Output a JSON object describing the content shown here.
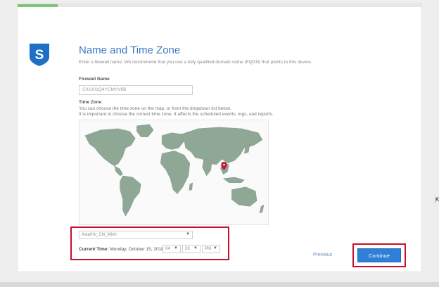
{
  "progress": {
    "fraction": 0.1
  },
  "header": {
    "logo_letter": "S",
    "title": "Name and Time Zone",
    "subtitle": "Enter a firewall name. We recommend that you use a fully qualified domain name (FQDN) that points to this device."
  },
  "firewall": {
    "label": "Firewall Name",
    "value": "C01001Q4YCMYV8B"
  },
  "timezone": {
    "label": "Time Zone",
    "help_line1": "You can choose the time zone on the map, or from the dropdown list below.",
    "help_line2": "It is important to choose the correct time zone. It affects the scheduled events, logs, and reports.",
    "selected": "Asia/Ho_Chi_Minh"
  },
  "current_time": {
    "label": "Current Time:",
    "date": "Monday, October 15, 2018,",
    "hour": "04",
    "minute": "33",
    "ampm": "PM"
  },
  "buttons": {
    "previous": "Previous",
    "continue": "Continue"
  },
  "colors": {
    "accent": "#2f7ed8",
    "highlight": "#c8102e",
    "map_land": "#8fa795",
    "map_pin": "#c8102e"
  },
  "icons": {
    "caret": "▼",
    "cursor": "⇱"
  }
}
